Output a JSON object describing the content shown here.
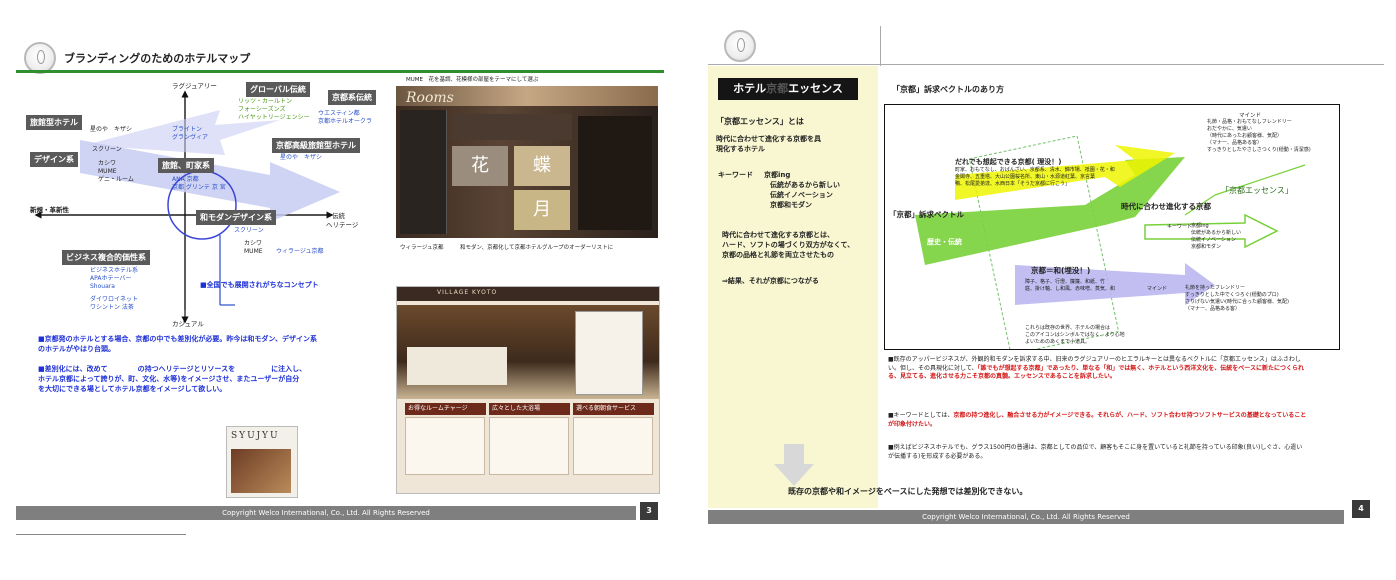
{
  "slide1": {
    "title": "ブランディングのためのホテルマップ",
    "axis": {
      "top": "ラグジュアリー",
      "bottom": "カジュアル",
      "left": "新規・革新性",
      "right_1": "伝統",
      "right_2": "ヘリテージ"
    },
    "categories": {
      "global": "グローバル伝統",
      "kyoto": "京都系伝統",
      "kyoto_luxury": "京都高級旅館型ホテル",
      "ryokan": "旅館型ホテル",
      "design": "デザイン系",
      "ryokan_design": "旅館、町家系",
      "wamodern": "和モダンデザイン系",
      "business": "ビジネス複合的価性系"
    },
    "hotels": {
      "global": [
        "リッツ・カールトン",
        "フォーシーズンズ",
        "ハイヤットリージェンシー"
      ],
      "kyoto": [
        "ウエスティン都",
        "京都ホテルオークラ"
      ],
      "kyoto_luxury": [
        "星のや　キザシ"
      ],
      "ryokan": [
        "星のや　キザシ"
      ],
      "design": [
        "ブライトン",
        "グランヴィア"
      ],
      "design_list": [
        "スクリーン",
        "カシワ",
        "MUME",
        "ゲニ・ルーム"
      ],
      "ryokan_design": [
        "ANA 京都",
        "京都 グリンテ 京 宮"
      ],
      "wamodern": [
        "スクリーン",
        "カシワ",
        "MUME",
        "ウィラージュ京都"
      ],
      "business": [
        "ビジネスホテル系",
        "APAホテーバー",
        "Shouara",
        "ダイワロイネット",
        "ワシントン 法茶"
      ]
    },
    "blue_note": "■全国でも展開されがちなコンセプト",
    "para1": [
      "■京都発のホテルとする場合、京都の中でも差別化が必要。昨今は和モダン、デザイン系",
      "のホテルがやはり台頭。"
    ],
    "para2_a": "■差別化には、改めて",
    "para2_b": "の持つヘリテージとリソースを",
    "para2_c": "に注入し、",
    "para2_2": "ホテル京都によって誇りが、町、文化、水等)をイメージさせ、またユーザーが自分",
    "para2_3": "を大切にできる場としてホテル京都をイメージして欲しい。",
    "photo1_caption": "MUME　花を基調、花模様の部屋をテーマにして選ぶ",
    "photo1_rooms": "Rooms",
    "photo1_kanji": [
      "花",
      "蝶",
      "月"
    ],
    "photo1_sub": "ウィラージュ京都　　　和モダン、京都化して京都ホテルグループのオーダーリストに",
    "photo2_brand": "VILLAGE KYOTO",
    "photo2_cards": [
      "お得なルームチャージ",
      "広々とした大浴場",
      "選べる朝朝食サービス"
    ],
    "photo3_brand": "SYUJYU",
    "footer": "Copyright  Welco  International,  Co.,  Ltd.  All  Rights  Reserved",
    "page": "3"
  },
  "slide2": {
    "header_title_1": "ホテル",
    "header_title_2": "京都",
    "header_title_3": "エッセンス",
    "subtitle": "「京都」訴求ベクトルのあり方",
    "left_heading": "「京都エッセンス」とは",
    "left_def": [
      "時代に合わせて進化する京都を具",
      "現化するホテル"
    ],
    "keyword_label": "キーワード",
    "keywords": [
      "京都ing",
      "伝統があるから新しい",
      "伝統イノベーション",
      "京都和モダン"
    ],
    "left_para": [
      "時代に合わせて進化する京都とは、",
      "ハード、ソフトの場づくり双方がなくて、",
      "京都の品格と礼節を両立させたもの"
    ],
    "left_result": "⇒結果、それが京都につながる",
    "diagram": {
      "vector_label": "「京都」訴求ベクトル",
      "yellow_title": "だれでも想起できる京都( 理没！)",
      "yellow_desc": [
        "町家、おもてなし、おばんざい、京都系、清水、錦市場、祇園・花・和",
        "金閣寺、五重塔、大山公園桜名所、東山・水源道紅葉、京言葉",
        "鴨、松尾愛弟達、水西日本「そうだ京都に行こう」"
      ],
      "green_text": "歴史・伝統",
      "purple_title": "京都＝和(埋没！)",
      "purple_desc": [
        "障子、格子、行燈、簾簾、和紙、竹",
        "庭、掛け軸、し和風、赤味噌、蒸気、和"
      ],
      "purple_note": [
        "これらは既存の世界、ホテルの場合は",
        "このアイコンはシンボルではなく、より心地",
        "よいためのあくまで小道具。"
      ],
      "mind_label": "マインド",
      "mind_list": [
        "礼節・品格・おもてなしフレンドリー",
        "おだやかに、気遣い",
        "（時代にあったお顧客様、気配）",
        "（マナー、品格ある客）",
        "すっきりとしたやさしさつくり(穏動・清潔感)"
      ],
      "essence_label": "「京都エッセンス」",
      "evolve_label": "時代に合わせ進化する京都",
      "kw_label": "キーワード",
      "kw_list": [
        "京都ing",
        "伝統があるから新しい",
        "伝統イノベーション",
        "京都和モダン"
      ],
      "mind2_label": "マインド",
      "mind2_list": [
        "礼節を持ったフレンドリー",
        "すっきりとした中でくつろぐ(穏動のプロ)",
        "さりげない気遣い(時代に合った顧客様、気配)",
        "（マナー、品格ある客）"
      ]
    },
    "bullets": [
      {
        "pre": "■既存のアッパービジネスが、外観的和モダンを訴求する中、旧来のラグジュアリーのヒエラルキーとは異なるベクトルに「京都エッセンス」はふさわしい。但し、その具現化に対して、",
        "red": "「誰でもが想起する京都」",
        "post": "であったり、単なる「和」では無く、ホテルという西洋文化を、伝統をベースに新たにつくられる、見立てる、進化させる力こそ京都の真髄。エッセンスであることを訴求したい。"
      },
      {
        "pre": "■キーワードとしては、",
        "red": "京都の持つ進化し、融合させる力がイメージできる。それらが、ハード、ソフト合わせ持つソフトサービスの基礎となっていることが印象付けたい。",
        "post": ""
      },
      {
        "pre": "■例えばビジネスホテルでも、グラス1500円の普通は、京都としての品位で、顧客もそこに身を置いていると礼節を持っている印象(良い)しぐさ、心遣いが伝播する)を形成する必要がある。",
        "red": "",
        "post": ""
      }
    ],
    "bottom_text": "既存の京都や和イメージをベースにした発想では差別化できない。",
    "footer": "Copyright  Welco  International,  Co.,  Ltd.  All  Rights  Reserved",
    "page": "4"
  },
  "colors": {
    "title_bar_green": "#2f8f2f",
    "footer_gray": "#7f7f7f",
    "yellow": "#f2f200",
    "purple": "#b9b3f0",
    "green_arrow": "#6fce2b",
    "left_panel_bg": "#f8f7d2"
  }
}
